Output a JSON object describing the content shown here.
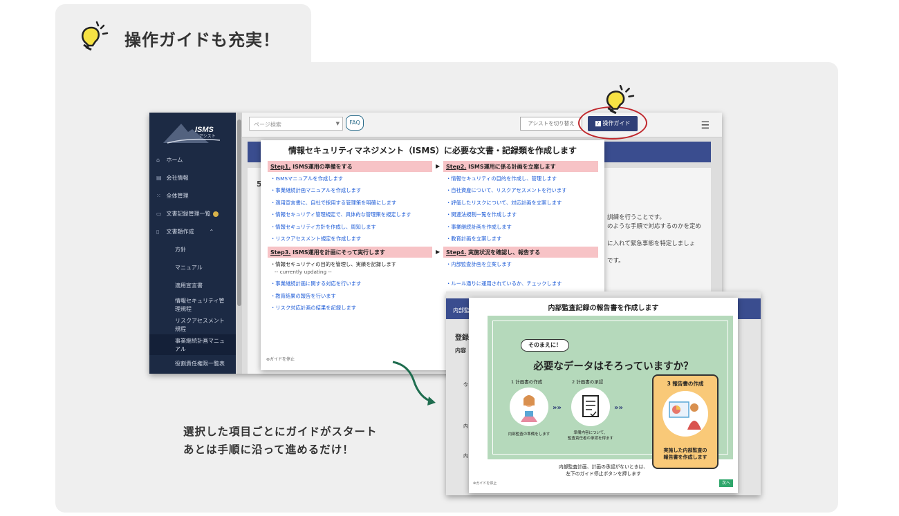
{
  "heading": "操作ガイドも充実！",
  "caption": {
    "line1": "選択した項目ごとにガイドがスタート",
    "line2": "あとは手順に沿って進めるだけ！"
  },
  "app": {
    "logo_text": "ISMS",
    "logo_sub": "アシスト",
    "search_placeholder": "ページ検索",
    "faq_label": "FAQ",
    "assist_toggle": "アシストを切り替え",
    "guide_button": "操作ガイド",
    "sidebar": {
      "home": "ホーム",
      "company": "会社情報",
      "overall": "全体管理",
      "doc_list": "文書記録管理一覧",
      "doc_create": "文書類作成",
      "policy": "方針",
      "manual": "マニュアル",
      "soa": "適用宣言書",
      "info_sec_1": "情報セキュリティ管",
      "info_sec_2": "理規程",
      "risk_1": "リスクアセスメント",
      "risk_2": "規程",
      "bcp_1": "事業継続計画マニュ",
      "bcp_2": "アル",
      "roles": "役割責任権限一覧表"
    },
    "bg_text": {
      "line1": "訓練を行うことです。",
      "line2": "のような手順で対応するのかを定め",
      "line3": "に入れて緊急事態を特定しましょ",
      "line4": "です。",
      "num": "5"
    }
  },
  "guide1": {
    "title": "情報セキュリティマネジメント（ISMS）に必要な文書・記録類を作成します",
    "step1": {
      "head": "Step1.",
      "title": " ISMS運用の準備をする",
      "items": [
        "・ISMSマニュアルを作成します",
        "・事業継続計画マニュアルを作成します",
        "・適用宣言書に、自社で採用する管理策を明確にします",
        "・情報セキュリティ管理規定で、具体的な管理策を規定します",
        "・情報セキュリティ方針を作成し、周知します",
        "・リスクアセスメント規定を作成します"
      ]
    },
    "step2": {
      "head": "Step2.",
      "title": " ISMS運用に係る計画を立案します",
      "items": [
        "・情報セキュリティの目的を作成し、管理します",
        "・自社資産について、リスクアセスメントを行います",
        "・評価したリスクについて、対応計画を立案します",
        "・関連法規制一覧を作成します",
        "・事業継続計画を作成します",
        "・教育計画を立案します"
      ]
    },
    "step3": {
      "head": "Step3.",
      "title": " ISMS運用を計画にそって実行します",
      "items": [
        "・情報セキュリティの目的を管理し、実績を記録します",
        "--  currently updating --",
        "・事業継続計画に関する対応を行います",
        "・教育結果の報告を行います",
        "・リスク対応計画の結果を記録します"
      ]
    },
    "step4": {
      "head": "Step4.",
      "title": " 実施状況を確認し、報告する",
      "items": [
        "・内部監査計画を立案します",
        "・ルール通りに運用されているか、チェックします"
      ]
    },
    "stop_label": "ガイドを停止"
  },
  "app2": {
    "bar_label": "内部監",
    "label1": "登録",
    "label2": "内容",
    "label3": "今",
    "label4": "内",
    "label5": "内"
  },
  "guide2": {
    "title": "内部監査記録の報告書を作成します",
    "bubble": "そのまえに！",
    "question": "必要なデータはそろっていますか？",
    "s1_label": "1 計画書の作成",
    "s1_caption": "内部監査の準備をします",
    "s2_label": "2 計画書の承認",
    "s2_caption_1": "準備内容について、",
    "s2_caption_2": "監査責任者の承認を得ます",
    "s3_label": "3 報告書の作成",
    "s3_desc_1": "実施した内部監査の",
    "s3_desc_2": "報告書を作成します",
    "foot_1": "内部監査計画、計画の承認がないときは、",
    "foot_2": "左下のガイド停止ボタンを押します",
    "next": "次へ",
    "stop_label": "ガイドを停止"
  },
  "colors": {
    "accent": "#3a4d8f",
    "step_bg": "#f7c3c6",
    "link": "#1a59d6",
    "green_panel": "#b5d9bb",
    "highlight_ring": "#c0282d"
  }
}
